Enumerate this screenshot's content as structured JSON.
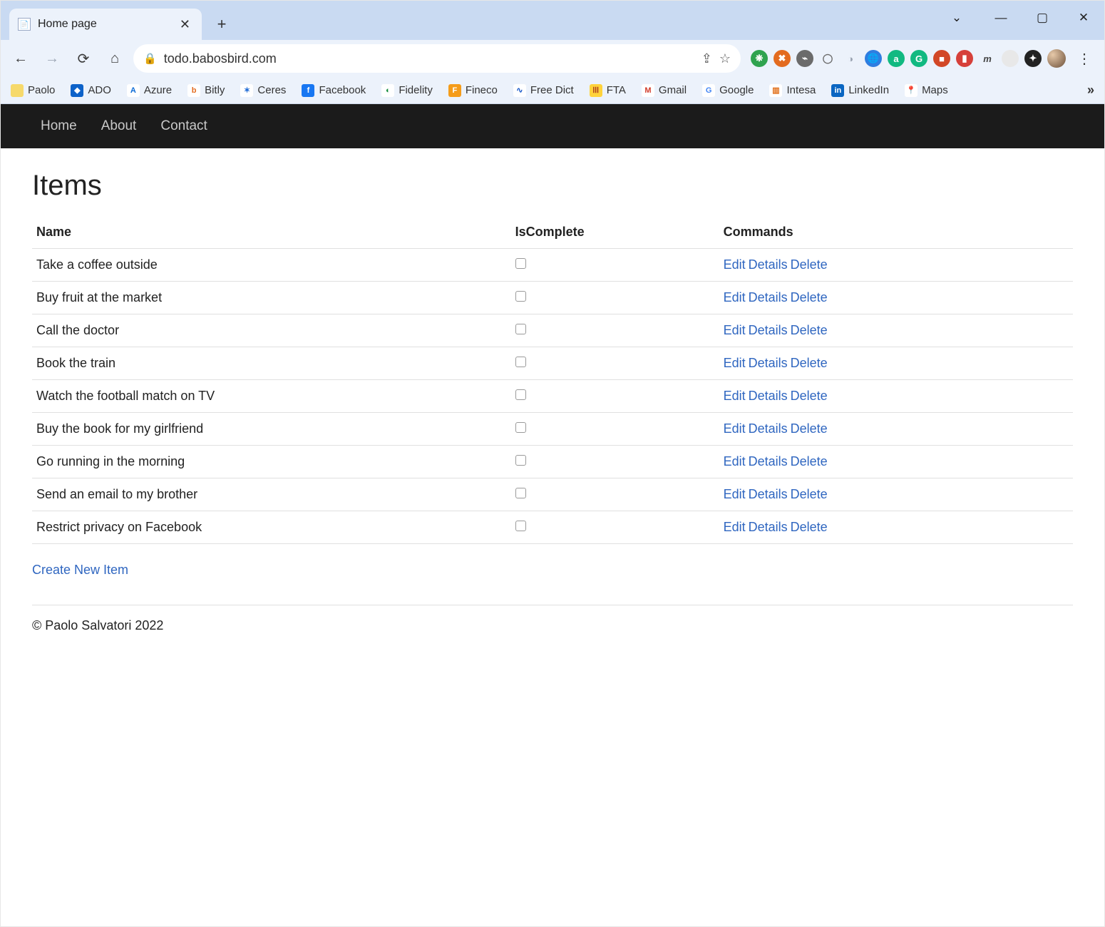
{
  "browser": {
    "tab_title": "Home page",
    "url": "todo.babosbird.com",
    "bookmarks": [
      {
        "label": "Paolo",
        "bg": "#f6d96b",
        "fg": "#333",
        "glyph": ""
      },
      {
        "label": "ADO",
        "bg": "#0d62c9",
        "fg": "#fff",
        "glyph": "◆"
      },
      {
        "label": "Azure",
        "bg": "#ffffff",
        "fg": "#0a6ad6",
        "glyph": "A"
      },
      {
        "label": "Bitly",
        "bg": "#ffffff",
        "fg": "#e36b1f",
        "glyph": "b"
      },
      {
        "label": "Ceres",
        "bg": "#ffffff",
        "fg": "#1f6bd6",
        "glyph": "✶"
      },
      {
        "label": "Facebook",
        "bg": "#1877f2",
        "fg": "#fff",
        "glyph": "f"
      },
      {
        "label": "Fidelity",
        "bg": "#ffffff",
        "fg": "#138b3b",
        "glyph": "◐"
      },
      {
        "label": "Fineco",
        "bg": "#f59c1a",
        "fg": "#fff",
        "glyph": "F"
      },
      {
        "label": "Free Dict",
        "bg": "#ffffff",
        "fg": "#1556c7",
        "glyph": "∿"
      },
      {
        "label": "FTA",
        "bg": "#ffd33b",
        "fg": "#a12b1b",
        "glyph": "Ⲽ"
      },
      {
        "label": "Gmail",
        "bg": "#ffffff",
        "fg": "#d23c2a",
        "glyph": "M"
      },
      {
        "label": "Google",
        "bg": "#ffffff",
        "fg": "#4285F4",
        "glyph": "G"
      },
      {
        "label": "Intesa",
        "bg": "#ffffff",
        "fg": "#e06a12",
        "glyph": "▥"
      },
      {
        "label": "LinkedIn",
        "bg": "#0a66c2",
        "fg": "#fff",
        "glyph": "in"
      },
      {
        "label": "Maps",
        "bg": "#ffffff",
        "fg": "#d43b2b",
        "glyph": "📍"
      }
    ],
    "extensions": [
      {
        "bg": "#2fa34f",
        "glyph": "❋"
      },
      {
        "bg": "#e36b1f",
        "glyph": "✖"
      },
      {
        "bg": "#6b6b6b",
        "glyph": "⌁"
      },
      {
        "bg": "#ffffff00",
        "glyph": "◯",
        "fg": "#6b6b6b"
      },
      {
        "bg": "#ffffff00",
        "glyph": "◑",
        "fg": "#9aa3b1"
      },
      {
        "bg": "#2f7de0",
        "glyph": "🌐"
      },
      {
        "bg": "#11b981",
        "glyph": "a"
      },
      {
        "bg": "#11b981",
        "glyph": "G"
      },
      {
        "bg": "#d24726",
        "glyph": "■"
      },
      {
        "bg": "#d6403a",
        "glyph": "▮"
      },
      {
        "bg": "#ffffff00",
        "glyph": "m",
        "fg": "#444",
        "italic": true
      },
      {
        "bg": "#e8e8e8",
        "glyph": ""
      },
      {
        "bg": "#222",
        "glyph": "✦"
      }
    ]
  },
  "nav": {
    "items": [
      "Home",
      "About",
      "Contact"
    ]
  },
  "page": {
    "title": "Items",
    "columns": {
      "name": "Name",
      "complete": "IsComplete",
      "commands": "Commands"
    },
    "rows": [
      {
        "name": "Take a coffee outside",
        "complete": false
      },
      {
        "name": "Buy fruit at the market",
        "complete": false
      },
      {
        "name": "Call the doctor",
        "complete": false
      },
      {
        "name": "Book the train",
        "complete": false
      },
      {
        "name": "Watch the football match on TV",
        "complete": false
      },
      {
        "name": "Buy the book for my girlfriend",
        "complete": false
      },
      {
        "name": "Go running in the morning",
        "complete": false
      },
      {
        "name": "Send an email to my brother",
        "complete": false
      },
      {
        "name": "Restrict privacy on Facebook",
        "complete": false
      }
    ],
    "commands": {
      "edit": "Edit",
      "details": "Details",
      "delete": "Delete"
    },
    "create_label": "Create New Item",
    "footer": "© Paolo Salvatori 2022"
  }
}
